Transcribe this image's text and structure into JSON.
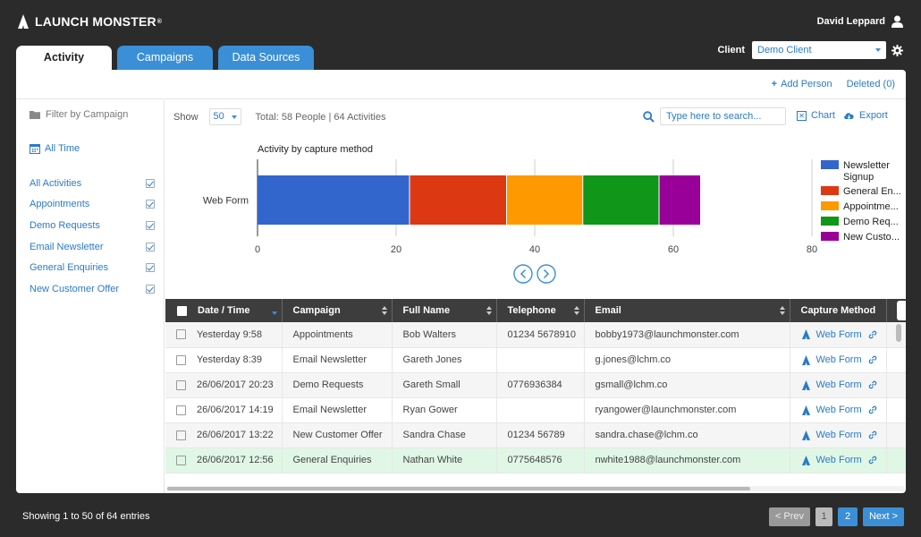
{
  "app": {
    "logo_text": "LAUNCH MONSTER",
    "logo_mark": "®",
    "user_name": "David Leppard"
  },
  "tabs": [
    {
      "label": "Activity",
      "active": true
    },
    {
      "label": "Campaigns",
      "active": false
    },
    {
      "label": "Data Sources",
      "active": false
    }
  ],
  "client": {
    "label": "Client",
    "selected": "Demo Client"
  },
  "top_links": {
    "add_person": "Add Person",
    "deleted": "Deleted (0)"
  },
  "sidebar": {
    "filter_label": "Filter by Campaign",
    "date_range": "All Time",
    "campaigns": [
      {
        "label": "All Activities",
        "checked": true
      },
      {
        "label": "Appointments",
        "checked": true
      },
      {
        "label": "Demo Requests",
        "checked": true
      },
      {
        "label": "Email Newsletter",
        "checked": true
      },
      {
        "label": "General Enquiries",
        "checked": true
      },
      {
        "label": "New Customer Offer",
        "checked": true
      }
    ]
  },
  "toolbar": {
    "show_label": "Show",
    "show_value": "50",
    "total": "Total: 58 People | 64 Activities",
    "search_placeholder": "Type here to search...",
    "chart_label": "Chart",
    "export_label": "Export"
  },
  "chart_data": {
    "type": "bar",
    "orientation": "horizontal",
    "stacked": true,
    "title": "Activity by capture method",
    "categories": [
      "Web Form"
    ],
    "series": [
      {
        "name": "Newsletter Signup",
        "values": [
          22
        ],
        "color": "#3366cc"
      },
      {
        "name": "General En...",
        "values": [
          14
        ],
        "color": "#dc3912"
      },
      {
        "name": "Appointme...",
        "values": [
          11
        ],
        "color": "#ff9900"
      },
      {
        "name": "Demo Req...",
        "values": [
          11
        ],
        "color": "#109618"
      },
      {
        "name": "New Custo...",
        "values": [
          6
        ],
        "color": "#990099"
      }
    ],
    "xlim": [
      0,
      80
    ],
    "xticks": [
      0,
      20,
      40,
      60,
      80
    ],
    "legend": "right",
    "grid": true
  },
  "table": {
    "columns": [
      "Date / Time",
      "Campaign",
      "Full Name",
      "Telephone",
      "Email",
      "Capture Method"
    ],
    "rows": [
      {
        "date": "Yesterday 9:58",
        "campaign": "Appointments",
        "name": "Bob Walters",
        "phone": "01234 5678910",
        "email": "bobby1973@launchmonster.com",
        "method": "Web Form"
      },
      {
        "date": "Yesterday 8:39",
        "campaign": "Email Newsletter",
        "name": "Gareth Jones",
        "phone": "",
        "email": "g.jones@lchm.co",
        "method": "Web Form"
      },
      {
        "date": "26/06/2017 20:23",
        "campaign": "Demo Requests",
        "name": "Gareth Small",
        "phone": "0776936384",
        "email": "gsmall@lchm.co",
        "method": "Web Form"
      },
      {
        "date": "26/06/2017 14:19",
        "campaign": "Email Newsletter",
        "name": "Ryan Gower",
        "phone": "",
        "email": "ryangower@launchmonster.com",
        "method": "Web Form"
      },
      {
        "date": "26/06/2017 13:22",
        "campaign": "New Customer Offer",
        "name": "Sandra Chase",
        "phone": "01234 56789",
        "email": "sandra.chase@lchm.co",
        "method": "Web Form"
      },
      {
        "date": "26/06/2017 12:56",
        "campaign": "General Enquiries",
        "name": "Nathan White",
        "phone": "0775648576",
        "email": "nwhite1988@launchmonster.com",
        "method": "Web Form",
        "highlight": true
      }
    ]
  },
  "footer": {
    "entries": "Showing 1 to 50 of 64 entries",
    "prev": "< Prev",
    "page1": "1",
    "page2": "2",
    "next": "Next >"
  },
  "colors": {
    "accent": "#3a8fd6",
    "link": "#2a7bc8",
    "header_bg": "#3d3d3d",
    "highlight_row": "#e0f7e5"
  }
}
